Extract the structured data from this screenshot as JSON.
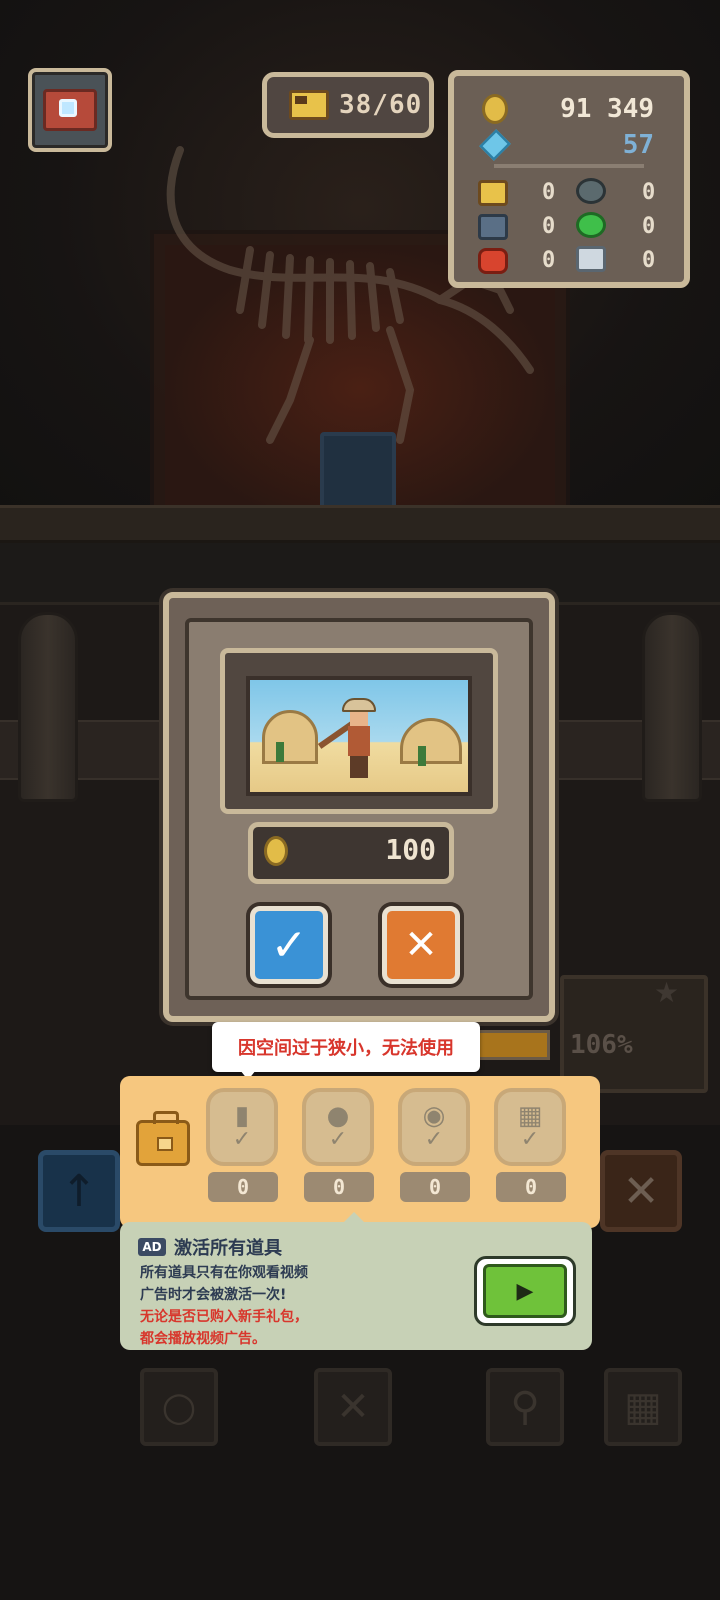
{
  "hud": {
    "energy": "38/60",
    "coins": "91 349",
    "gems": "57",
    "inventory": [
      "0",
      "0",
      "0",
      "0",
      "0",
      "0"
    ],
    "icons": [
      "camera-icon",
      "energy-truck-icon",
      "coin-icon",
      "gem-icon",
      "magnifier-icon",
      "bucket-icon",
      "potion-icon",
      "bag-icon",
      "robot-icon"
    ]
  },
  "modal": {
    "price": "100",
    "confirm_symbol": "✓",
    "cancel_symbol": "✕"
  },
  "background": {
    "progress_percent": "106%",
    "star": "★",
    "left_tool_symbol": "↑",
    "right_tool_symbol": "✕"
  },
  "tooltip": {
    "text": "因空间过于狭小，无法使用"
  },
  "toolbox": {
    "slots": [
      {
        "name": "bucket",
        "glyph": "▮",
        "check": "✓",
        "count": "0"
      },
      {
        "name": "potion",
        "glyph": "●",
        "check": "✓",
        "count": "0"
      },
      {
        "name": "bag",
        "glyph": "◉",
        "check": "✓",
        "count": "0"
      },
      {
        "name": "robot",
        "glyph": "▦",
        "check": "✓",
        "count": "0"
      }
    ]
  },
  "ad": {
    "badge": "AD",
    "title": "激活所有道具",
    "line1": "所有道具只有在你观看视频",
    "line2": "广告时才会被激活一次!",
    "line3": "无论是否已购入新手礼包，",
    "line4": "都会播放视频广告。",
    "play_symbol": "▶",
    "colors": {
      "normal": "#2d3b52",
      "warning": "#d8362c"
    }
  }
}
